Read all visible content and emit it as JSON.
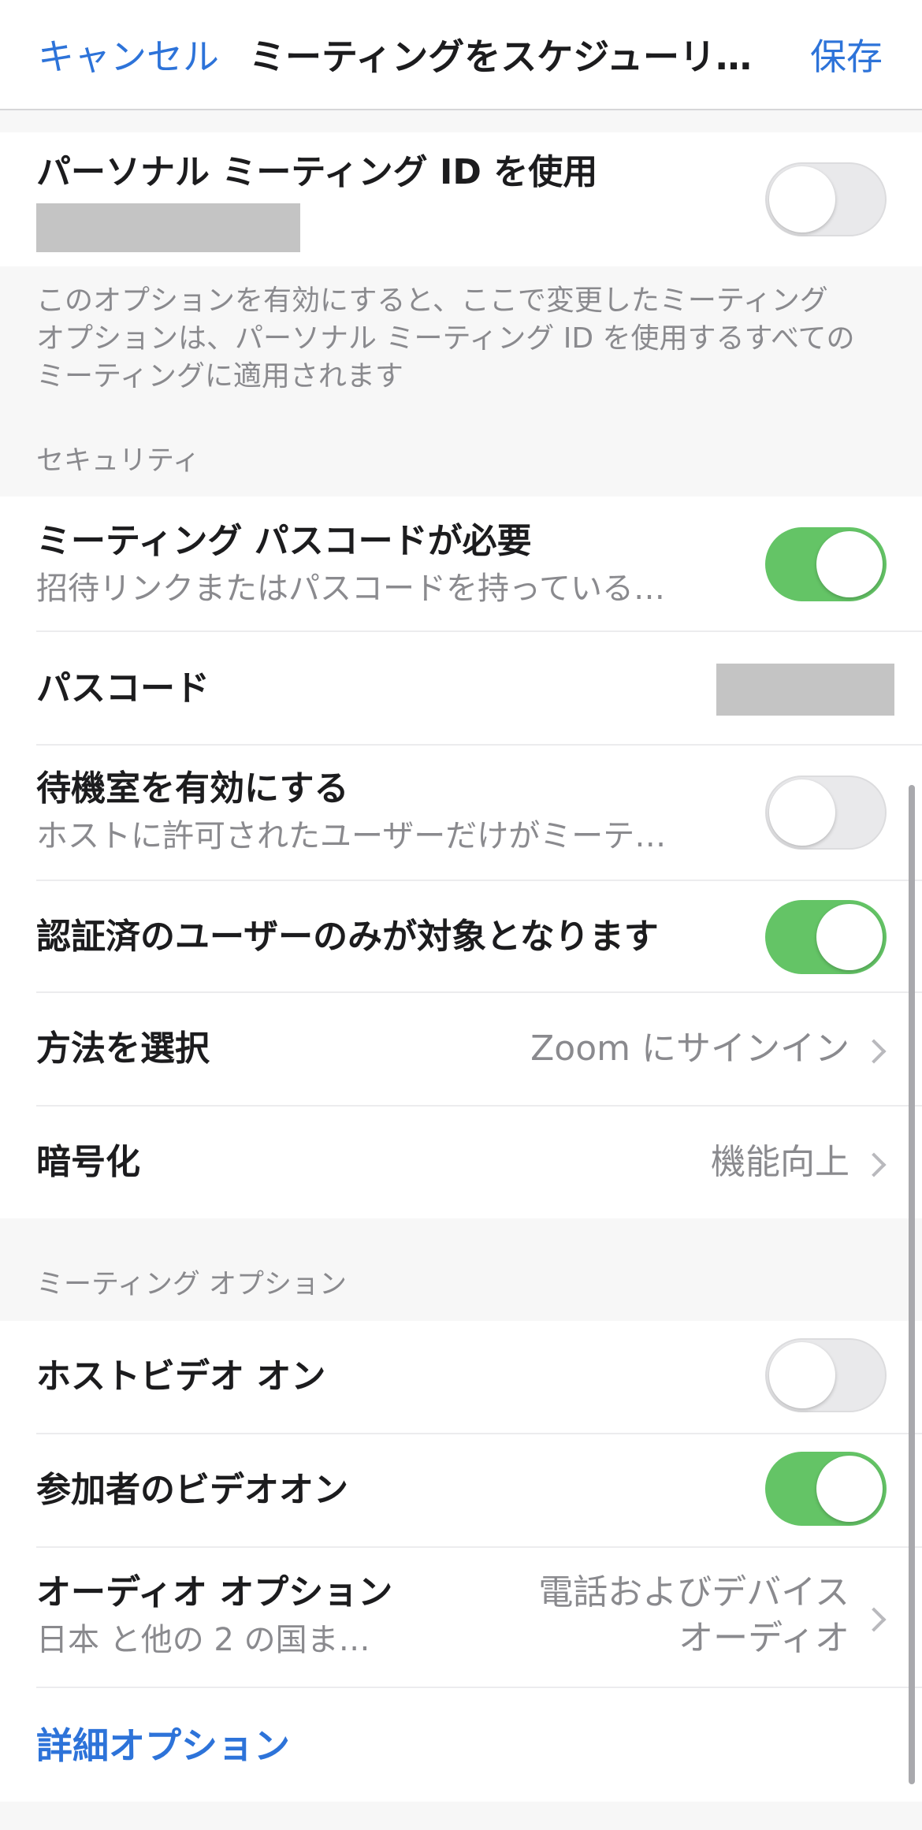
{
  "nav": {
    "cancel_label": "キャンセル",
    "title": "ミーティングをスケジューリ…",
    "save_label": "保存"
  },
  "pmi": {
    "title": "パーソナル ミーティング ID を使用",
    "toggle_state": "off",
    "note_lines": [
      "このオプションを有効にすると、ここで変更したミーティング",
      "オプションは、パーソナル ミーティング ID を使用するすべての",
      "ミーティングに適用されます"
    ]
  },
  "security": {
    "header": "セキュリティ",
    "rows": [
      {
        "title": "ミーティング パスコードが必要",
        "subtitle": "招待リンクまたはパスコードを持っている…",
        "toggle_state": "on"
      },
      {
        "title": "パスコード"
      },
      {
        "title": "待機室を有効にする",
        "subtitle": "ホストに許可されたユーザーだけがミーテ…",
        "toggle_state": "off"
      },
      {
        "title": "認証済のユーザーのみが対象となります",
        "toggle_state": "on"
      },
      {
        "title": "方法を選択",
        "value": "Zoom にサインイン"
      },
      {
        "title": "暗号化",
        "value": "機能向上"
      }
    ]
  },
  "meeting_options": {
    "header": "ミーティング オプション",
    "rows": [
      {
        "title": "ホストビデオ オン",
        "toggle_state": "off"
      },
      {
        "title": "参加者のビデオオン",
        "toggle_state": "on"
      },
      {
        "title": "オーディオ オプション",
        "subtitle": "日本 と他の 2 の国ま…",
        "value_lines": [
          "電話およびデバイス",
          "オーディオ"
        ]
      }
    ],
    "advanced_link": "詳細オプション"
  },
  "colors": {
    "accent_blue": "#2d73d9",
    "toggle_on": "#64c466",
    "toggle_off": "#e9e9eb",
    "secondary_text": "#8a8a8e",
    "redaction_gray": "#c4c4c4"
  }
}
